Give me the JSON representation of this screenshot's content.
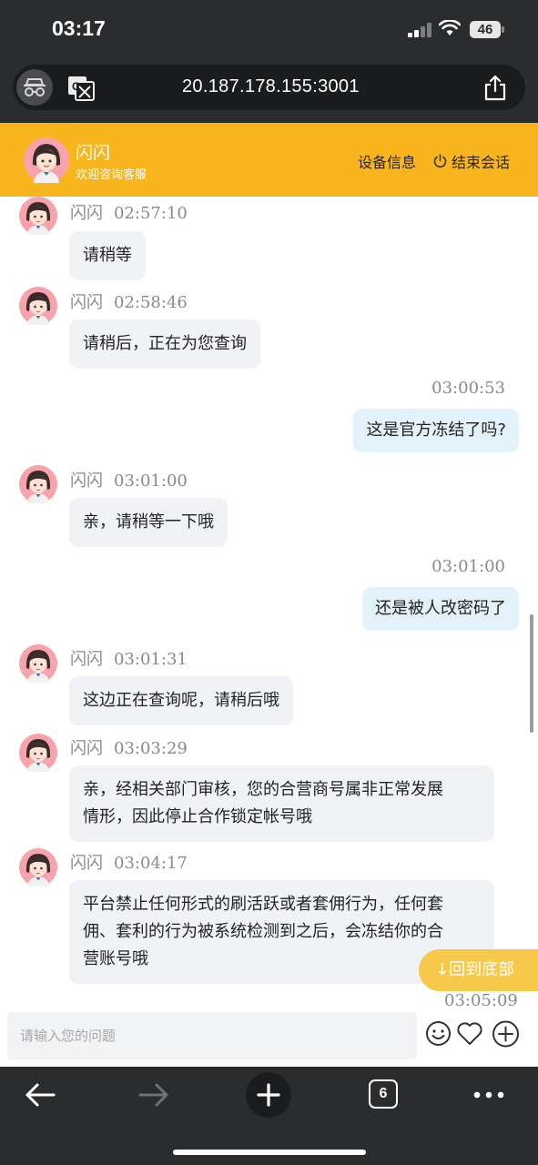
{
  "status_bar": {
    "time": "03:17",
    "battery": "46"
  },
  "browser": {
    "url": "20.187.178.155:3001",
    "tab_count": "6"
  },
  "header": {
    "agent_name": "闪闪",
    "subtitle": "欢迎咨询客服",
    "device_info": "设备信息",
    "end_session": "结束会话"
  },
  "messages": [
    {
      "sender": "闪闪",
      "time": "02:57:10",
      "text": "请稍等"
    },
    {
      "sender": "闪闪",
      "time": "02:58:46",
      "text": "请稍后，正在为您查询"
    },
    {
      "time": "03:00:53",
      "text": "这是官方冻结了吗?"
    },
    {
      "sender": "闪闪",
      "time": "03:01:00",
      "text": "亲，请稍等一下哦"
    },
    {
      "time": "03:01:00",
      "text": "还是被人改密码了"
    },
    {
      "sender": "闪闪",
      "time": "03:01:31",
      "text": "这边正在查询呢，请稍后哦"
    },
    {
      "sender": "闪闪",
      "time": "03:03:29",
      "lines": [
        "亲，经相关部门审核，您的合营商号属非正常发展",
        "情形，因此停止合作锁定帐号哦"
      ]
    },
    {
      "sender": "闪闪",
      "time": "03:04:17",
      "lines": [
        "平台禁止任何形式的刷活跃或者套佣行为，任何套",
        "佣、套利的行为被系统检测到之后，会冻结你的合",
        "营账号哦"
      ]
    }
  ],
  "partial_time": "03:05:09",
  "back_to_bottom": "↓回到底部",
  "input": {
    "placeholder": "请输入您的问题"
  }
}
